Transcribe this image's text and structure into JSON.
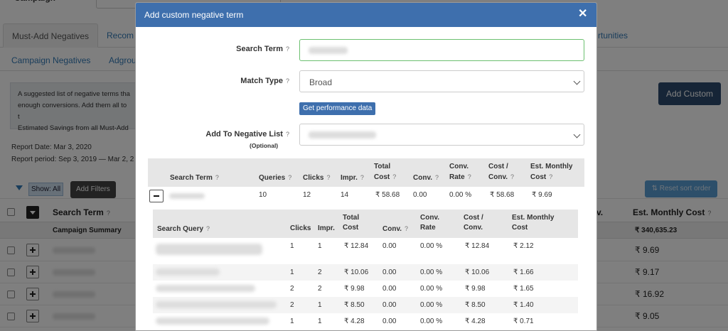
{
  "background": {
    "top_label": "Campaign",
    "tabs_row1": [
      "Must-Add Negatives",
      "Recom",
      "rtunities"
    ],
    "tabs_row2": [
      "Campaign Negatives",
      "Adgrou"
    ],
    "info_lines": [
      "A suggested list of negative terms tha",
      "enough conversions. Add them all to t",
      "Estimated Savings from all Must-Add"
    ],
    "add_custom_label": "Add Custom",
    "report_date": "Report Date:   Mar 3, 2020",
    "report_period": "Report period:  Sep 3, 2019 — Mar 2, 2",
    "show_all_label": "Show: All",
    "add_filters_label": "Add Filters",
    "reset_sort_label": "⇅ Reset sort order",
    "table": {
      "search_term_header": "Search Term",
      "conv_header_partial": "v.",
      "est_monthly_header": "Est. Monthly Cost",
      "campaign_summary_label": "Campaign Summary",
      "campaign_summary_value": "₹ 340,635.23",
      "row_values": [
        "₹ 9.69",
        "₹ 9.17",
        "₹ 16.92",
        "₹ 9.05"
      ]
    }
  },
  "modal": {
    "title": "Add custom negative term",
    "close_glyph": "✕",
    "search_term_label": "Search Term",
    "match_type_label": "Match Type",
    "match_type_value": "Broad",
    "get_performance_label": "Get performance data",
    "add_to_list_label": "Add To Negative List",
    "optional_label": "(Optional)",
    "qmark": "?",
    "table_headers": {
      "search_term": "Search Term",
      "queries": "Queries",
      "clicks": "Clicks",
      "impr": "Impr.",
      "total_cost_1": "Total",
      "total_cost_2": "Cost",
      "conv": "Conv.",
      "conv_rate_1": "Conv.",
      "conv_rate_2": "Rate",
      "cost_conv_1": "Cost /",
      "cost_conv_2": "Conv.",
      "est_monthly_1": "Est. Monthly",
      "est_monthly_2": "Cost"
    },
    "summary_row": {
      "queries": "10",
      "clicks": "12",
      "impr": "14",
      "total_cost": "₹ 58.68",
      "conv": "0.00",
      "conv_rate": "0.00 %",
      "cost_conv": "₹ 58.68",
      "est_monthly": "₹ 9.69"
    },
    "sub_headers": {
      "search_query": "Search Query",
      "clicks": "Clicks",
      "impr": "Impr.",
      "total_cost_1": "Total",
      "total_cost_2": "Cost",
      "conv": "Conv.",
      "conv_rate_1": "Conv.",
      "conv_rate_2": "Rate",
      "cost_conv_1": "Cost /",
      "cost_conv_2": "Conv.",
      "est_monthly_1": "Est. Monthly",
      "est_monthly_2": "Cost"
    },
    "sub_rows": [
      {
        "clicks": "1",
        "impr": "1",
        "total_cost": "₹ 12.84",
        "conv": "0.00",
        "conv_rate": "0.00 %",
        "cost_conv": "₹ 12.84",
        "est_monthly": "₹ 2.12"
      },
      {
        "clicks": "1",
        "impr": "2",
        "total_cost": "₹ 10.06",
        "conv": "0.00",
        "conv_rate": "0.00 %",
        "cost_conv": "₹ 10.06",
        "est_monthly": "₹ 1.66"
      },
      {
        "clicks": "2",
        "impr": "2",
        "total_cost": "₹ 9.98",
        "conv": "0.00",
        "conv_rate": "0.00 %",
        "cost_conv": "₹ 9.98",
        "est_monthly": "₹ 1.65"
      },
      {
        "clicks": "2",
        "impr": "1",
        "total_cost": "₹ 8.50",
        "conv": "0.00",
        "conv_rate": "0.00 %",
        "cost_conv": "₹ 8.50",
        "est_monthly": "₹ 1.40"
      },
      {
        "clicks": "1",
        "impr": "1",
        "total_cost": "₹ 4.28",
        "conv": "0.00",
        "conv_rate": "0.00 %",
        "cost_conv": "₹ 4.28",
        "est_monthly": "₹ 0.71"
      }
    ]
  }
}
